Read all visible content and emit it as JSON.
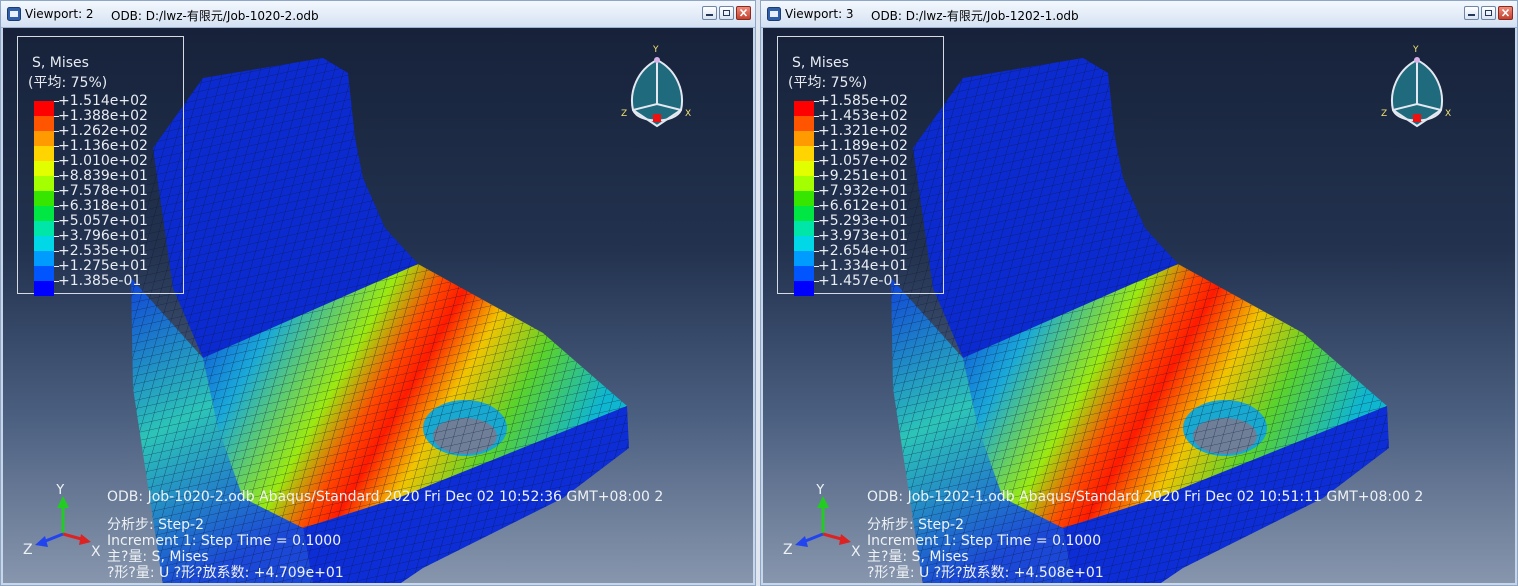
{
  "viewports": [
    {
      "title": "Viewport: 2",
      "odb_path": "ODB: D:/lwz-有限元/Job-1020-2.odb",
      "legend": {
        "title": "S, Mises",
        "subtitle": "(平均: 75%)",
        "values": [
          "+1.514e+02",
          "+1.388e+02",
          "+1.262e+02",
          "+1.136e+02",
          "+1.010e+02",
          "+8.839e+01",
          "+7.578e+01",
          "+6.318e+01",
          "+5.057e+01",
          "+3.796e+01",
          "+2.535e+01",
          "+1.275e+01",
          "+1.385e-01"
        ]
      },
      "info": {
        "odb_line": "ODB: Job-1020-2.odb    Abaqus/Standard 2020    Fri Dec 02 10:52:36 GMT+08:00 2",
        "step_line": "分析步: Step-2",
        "increment_line": "Increment       1: Step Time =    0.1000",
        "primary_line": "主?量: S, Mises",
        "deform_line": "?形?量: U   ?形?放系数: +4.709e+01"
      }
    },
    {
      "title": "Viewport: 3",
      "odb_path": "ODB: D:/lwz-有限元/Job-1202-1.odb",
      "legend": {
        "title": "S, Mises",
        "subtitle": "(平均: 75%)",
        "values": [
          "+1.585e+02",
          "+1.453e+02",
          "+1.321e+02",
          "+1.189e+02",
          "+1.057e+02",
          "+9.251e+01",
          "+7.932e+01",
          "+6.612e+01",
          "+5.293e+01",
          "+3.973e+01",
          "+2.654e+01",
          "+1.334e+01",
          "+1.457e-01"
        ]
      },
      "info": {
        "odb_line": "ODB: Job-1202-1.odb    Abaqus/Standard 2020    Fri Dec 02 10:51:11 GMT+08:00 2",
        "step_line": "分析步: Step-2",
        "increment_line": "Increment       1: Step Time =    0.1000",
        "primary_line": "主?量: S, Mises",
        "deform_line": "?形?量: U   ?形?放系数: +4.508e+01"
      }
    }
  ],
  "axis_labels": {
    "x": "X",
    "y": "Y",
    "z": "Z"
  },
  "legend_colors": [
    "#ff0000",
    "#ff5400",
    "#ff9a00",
    "#ffd400",
    "#e2ff00",
    "#a4ff00",
    "#36e600",
    "#00e642",
    "#00e6a8",
    "#00d8e8",
    "#009bff",
    "#0055ff",
    "#0000ff"
  ],
  "icons": [
    "viewport-icon",
    "minimize-icon",
    "restore-icon",
    "close-icon",
    "view-cube-icon",
    "triad-icon"
  ]
}
